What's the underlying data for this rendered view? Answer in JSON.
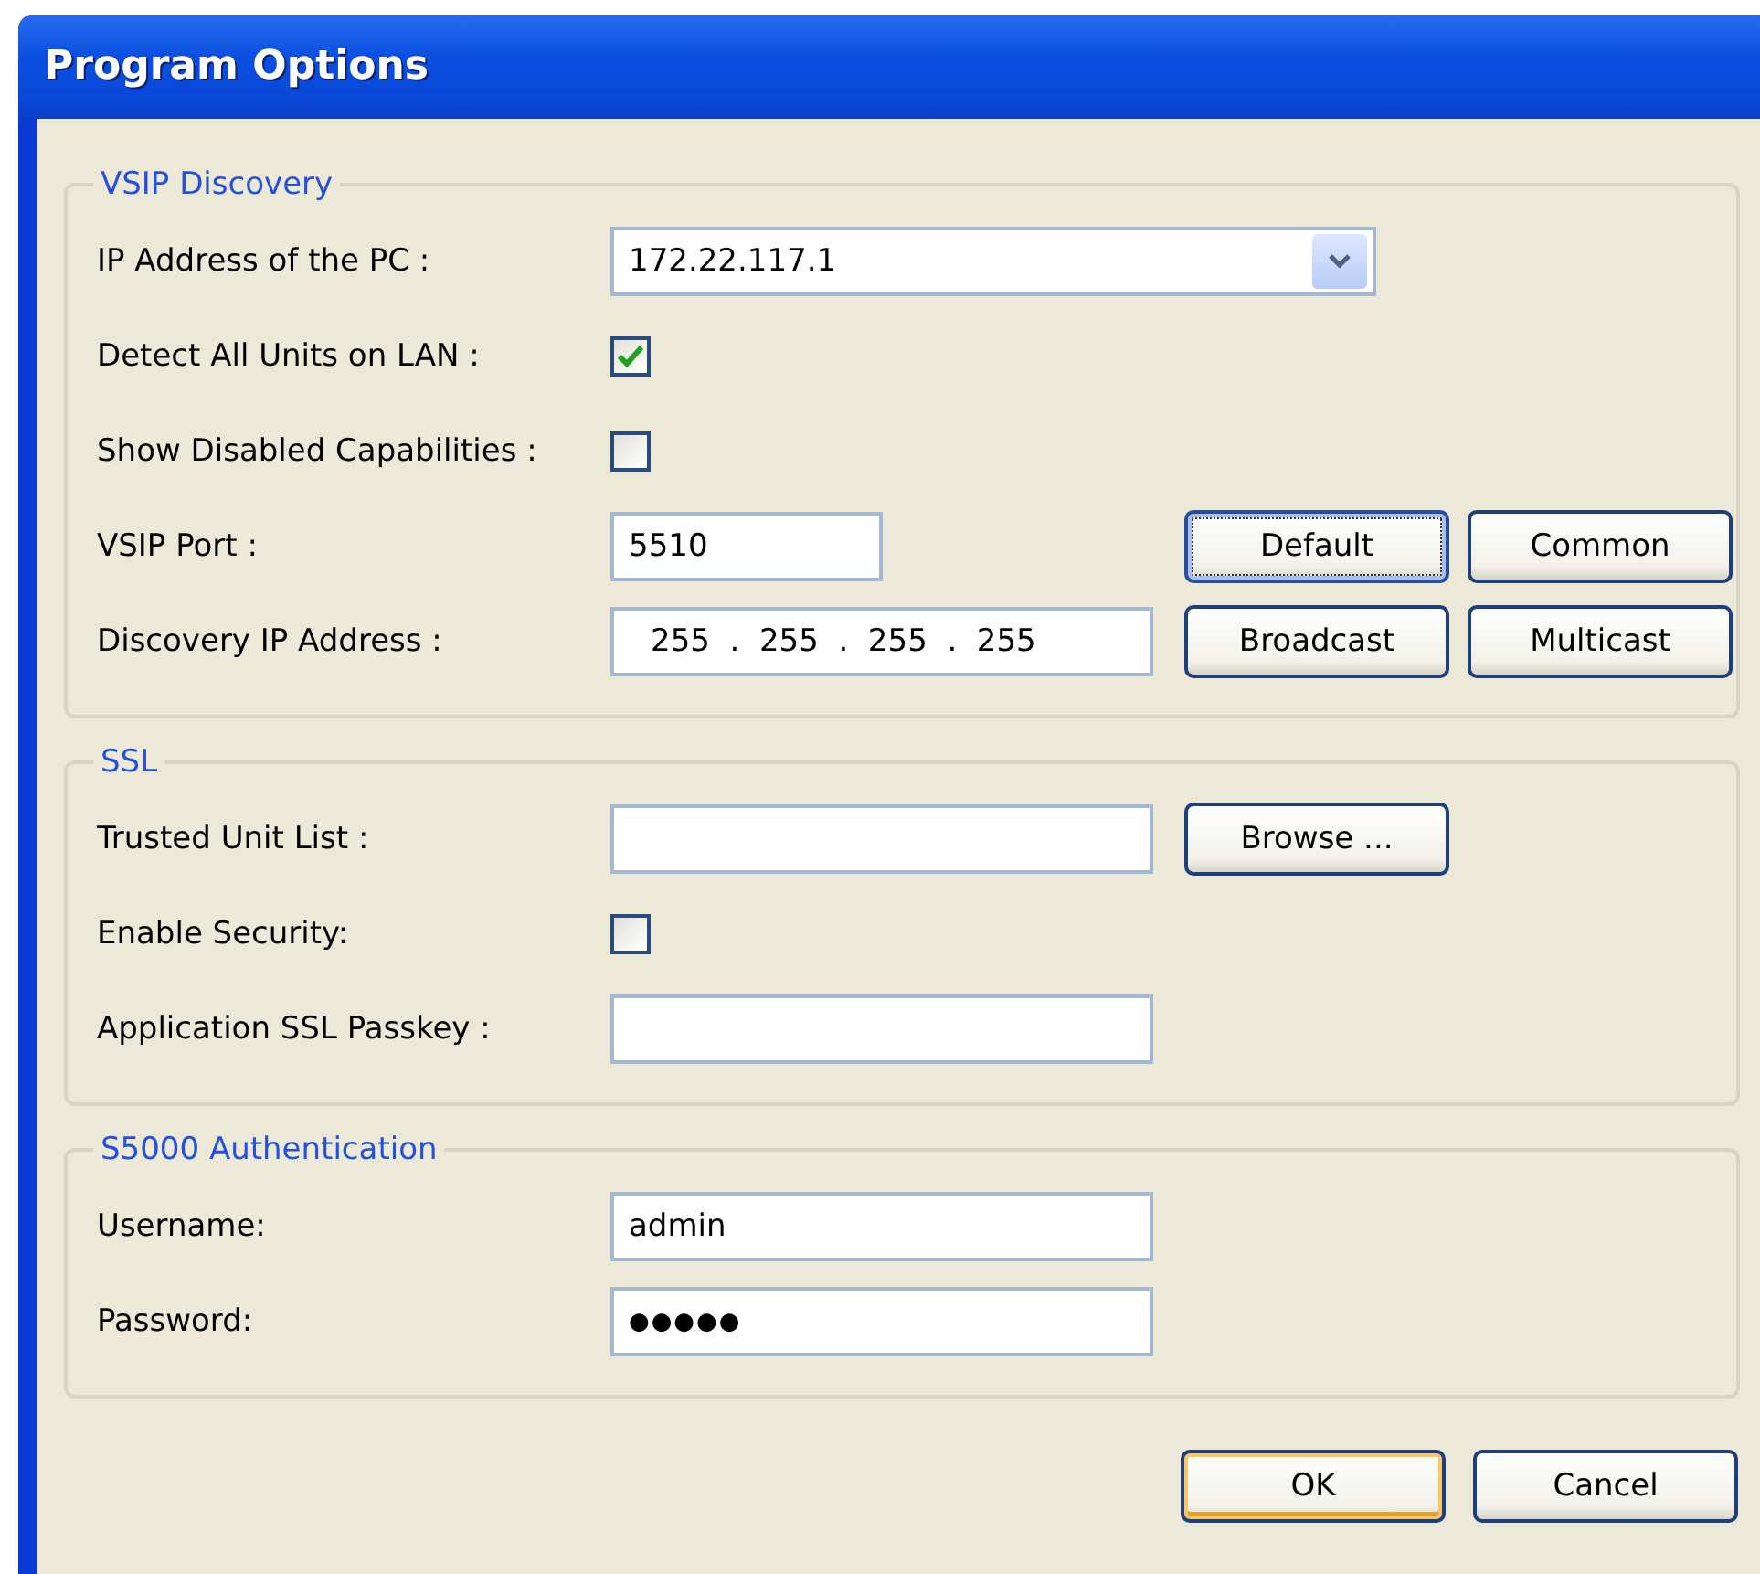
{
  "window": {
    "title": "Program Options"
  },
  "groups": [
    {
      "title": "VSIP Discovery",
      "rows": [
        {
          "kind": "combo",
          "label": "IP Address of the PC :",
          "value": "172.22.117.1"
        },
        {
          "kind": "checkbox",
          "label": "Detect All Units on LAN :",
          "checked": true
        },
        {
          "kind": "checkbox",
          "label": "Show Disabled Capabilities :",
          "checked": false
        },
        {
          "kind": "port",
          "label": "VSIP Port :",
          "value": "5510",
          "buttons": [
            {
              "label": "Default",
              "focused": true
            },
            {
              "label": "Common",
              "focused": false
            }
          ]
        },
        {
          "kind": "ip",
          "label": "Discovery IP Address :",
          "value": "255  .  255  .  255  .  255",
          "buttons": [
            {
              "label": "Broadcast",
              "focused": false
            },
            {
              "label": "Multicast",
              "focused": false
            }
          ]
        }
      ]
    },
    {
      "title": "SSL",
      "rows": [
        {
          "kind": "text",
          "label": "Trusted Unit List :",
          "buttons": [
            {
              "label": "Browse ...",
              "focused": false
            }
          ]
        },
        {
          "kind": "checkbox",
          "label": "Enable Security:",
          "checked": false
        },
        {
          "kind": "text",
          "label": "Application SSL Passkey :"
        }
      ]
    },
    {
      "title": "S5000 Authentication",
      "rows": [
        {
          "kind": "text",
          "label": "Username:",
          "value": "admin"
        },
        {
          "kind": "password",
          "label": "Password:",
          "value": "●●●●●"
        }
      ]
    }
  ],
  "buttons": [
    {
      "label": "OK",
      "default": true
    },
    {
      "label": "Cancel",
      "default": false
    }
  ]
}
